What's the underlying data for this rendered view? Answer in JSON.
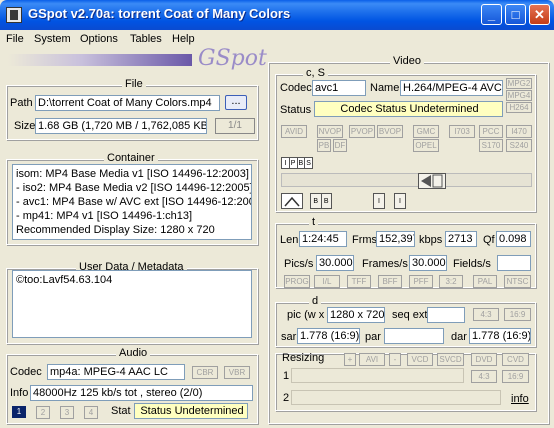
{
  "window": {
    "title": "GSpot v2.70a: torrent Coat of Many Colors"
  },
  "menu": [
    "File",
    "System",
    "Options",
    "Tables",
    "Help"
  ],
  "logo": "GSpot",
  "file": {
    "group_label": "File",
    "path_label": "Path",
    "path_value": "D:\\torrent Coat of Many Colors.mp4",
    "browse_label": "...",
    "size_label": "Size",
    "size_value": "1.68 GB (1,720 MB / 1,762,085 KB",
    "page_indicator": "1/1"
  },
  "container": {
    "group_label": "Container",
    "lines": [
      "isom: MP4  Base Media v1 [ISO 14496-12:2003]",
      "- iso2: MP4 Base Media v2 [ISO 14496-12:2005]",
      "- avc1: MP4 Base w/ AVC ext [ISO 14496-12:200",
      "- mp41: MP4 v1 [ISO 14496-1:ch13]",
      "Recommended Display Size: 1280 x 720"
    ]
  },
  "userdata": {
    "group_label": "User Data / Metadata",
    "text": "©too:Lavf54.63.104"
  },
  "audio": {
    "group_label": "Audio",
    "codec_label": "Codec",
    "codec_value": "mp4a: MPEG-4 AAC LC",
    "cbr_label": "CBR",
    "vbr_label": "VBR",
    "info_label": "Info",
    "info_value": "48000Hz  125 kb/s tot , stereo (2/0)",
    "stream_buttons": [
      "1",
      "2",
      "3",
      "4"
    ],
    "stat_label": "Stat",
    "status_value": "Status Undetermined"
  },
  "video": {
    "group_label": "Video",
    "cs_label": "c, S",
    "codec_label": "Codec",
    "codec_value": "avc1",
    "name_label": "Name",
    "name_value": "H.264/MPEG-4 AVC",
    "fmt_buttons": [
      "MPG2",
      "MPG4",
      "H264"
    ],
    "status_label": "Status",
    "status_value": "Codec Status Undetermined",
    "flag_buttons_row1": [
      "AVID",
      "NVOP",
      "PVOP",
      "BVOP",
      "GMC",
      "I703",
      "PCC",
      "I470"
    ],
    "flag_buttons_row2": [
      "PB",
      "DF",
      "OPEL",
      "S170",
      "S240"
    ],
    "frame_types": [
      "I",
      "P",
      "B",
      "S"
    ],
    "gop_labels": [
      "B",
      "B",
      "I",
      "I"
    ],
    "t_label": "t",
    "len_label": "Len",
    "len_value": "1:24:45",
    "frms_label": "Frms",
    "frms_value": "152,397",
    "kbps_label": "kbps",
    "kbps_value": "2713",
    "qf_label": "Qf",
    "qf_value": "0.098",
    "pics_label": "Pics/s",
    "pics_value": "30.000",
    "frames_label": "Frames/s",
    "frames_value": "30.000",
    "fields_label": "Fields/s",
    "fields_value": "",
    "pulldown_buttons": [
      "PROG",
      "I/L",
      "TFF",
      "BFF",
      "PFF",
      "3:2",
      "PAL",
      "NTSC"
    ],
    "d_label": "d",
    "pic_label": "pic (w x",
    "pic_value": "1280 x 720",
    "seqext_label": "seq ext",
    "ar_buttons": [
      "4:3",
      "16:9"
    ],
    "sar_label": "sar",
    "sar_value": "1.778 (16:9)",
    "par_label": "par",
    "par_value": "",
    "dar_label": "dar",
    "dar_value": "1.778 (16:9)",
    "resizing_label": "Resizing",
    "resize_buttons": [
      "+",
      "AVI",
      "-",
      "VCD",
      "SVCD",
      "DVD",
      "CVD"
    ],
    "row1_label": "1",
    "row2_label": "2",
    "row1_ar_buttons": [
      "4:3",
      "16:9"
    ],
    "info_link": "info"
  }
}
